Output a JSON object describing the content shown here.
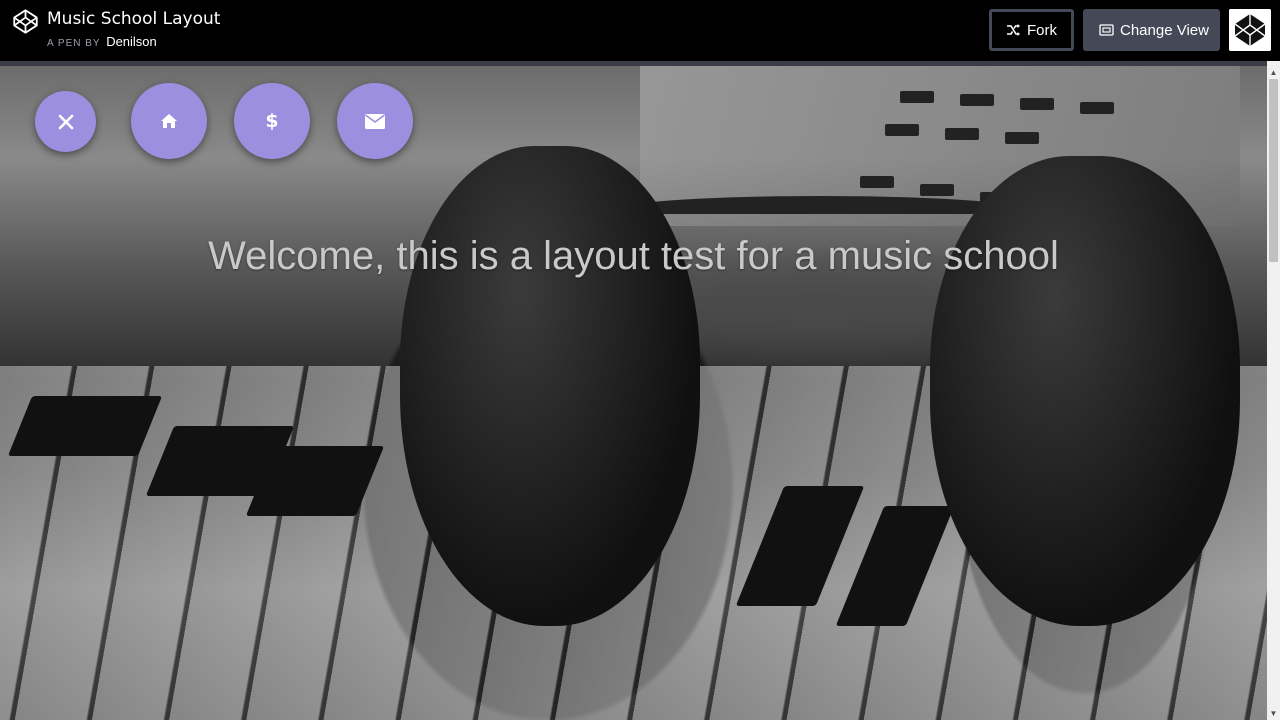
{
  "header": {
    "pen_title": "Music School Layout",
    "byline_prefix": "A PEN BY",
    "author": "Denilson",
    "fork_label": "Fork",
    "change_view_label": "Change View",
    "logo_icon": "codepen-logo-icon",
    "avatar_icon": "codepen-avatar-icon"
  },
  "nav": {
    "buttons": [
      {
        "icon": "close-icon",
        "glyph": "✕"
      },
      {
        "icon": "home-icon",
        "glyph": "⌂"
      },
      {
        "icon": "dollar-icon",
        "glyph": "$"
      },
      {
        "icon": "envelope-icon",
        "glyph": "✉"
      }
    ],
    "accent_color": "#9d8fe0"
  },
  "hero": {
    "welcome_text": "Welcome, this is a layout test for a music school"
  },
  "colors": {
    "topbar_bg": "#000000",
    "button_bg": "#444857",
    "welcome_text": "#c9c9c9"
  }
}
